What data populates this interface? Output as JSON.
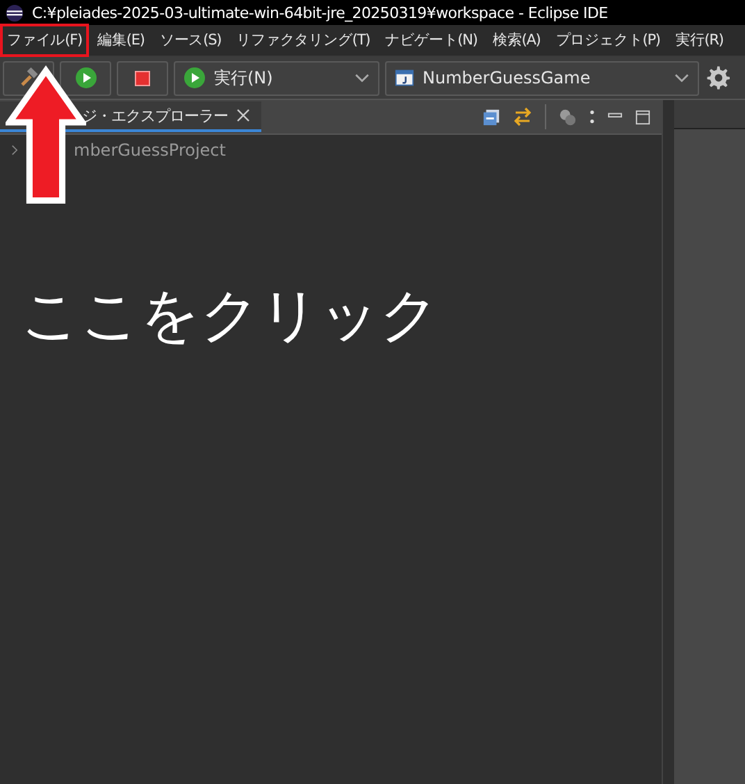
{
  "window": {
    "title": "C:¥pleiades-2025-03-ultimate-win-64bit-jre_20250319¥workspace - Eclipse IDE"
  },
  "menu": [
    {
      "label": "ファイル(F)",
      "highlighted": true
    },
    {
      "label": "編集(E)",
      "highlighted": false
    },
    {
      "label": "ソース(S)",
      "highlighted": false
    },
    {
      "label": "リファクタリング(T)",
      "highlighted": false
    },
    {
      "label": "ナビゲート(N)",
      "highlighted": false
    },
    {
      "label": "検索(A)",
      "highlighted": false
    },
    {
      "label": "プロジェクト(P)",
      "highlighted": false
    },
    {
      "label": "実行(R)",
      "highlighted": false
    }
  ],
  "toolbar": {
    "run_mode": "実行(N)",
    "launch_config": "NumberGuessGame"
  },
  "view": {
    "tab": "ジ・エクスプローラー",
    "tree_item": "mberGuessProject"
  },
  "annotation": {
    "text": "ここをクリック"
  }
}
